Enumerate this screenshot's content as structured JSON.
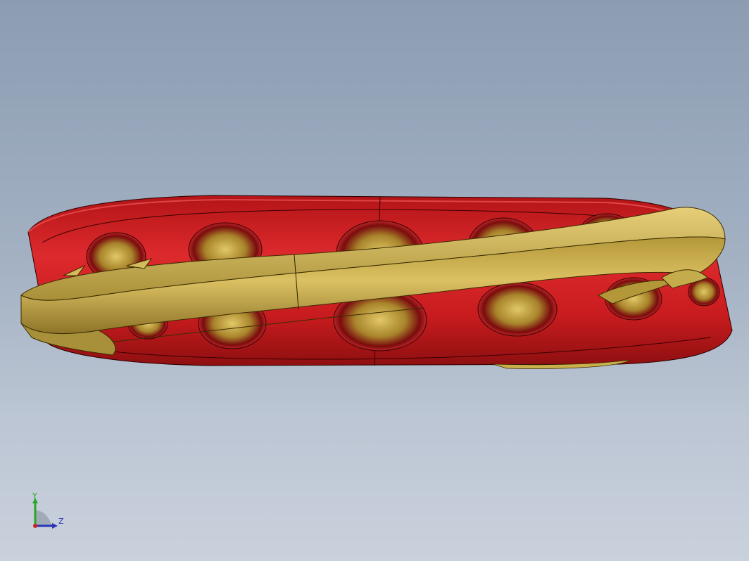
{
  "viewport": {
    "background_top": "#8c9db2",
    "background_bottom": "#c9d1dc"
  },
  "model": {
    "outer_ring_color": "#d5262a",
    "outer_ring_shadow": "#8e0f10",
    "cage_color": "#c9b04e",
    "cage_shadow": "#7a6523"
  },
  "triad": {
    "y_label": "Y",
    "z_label": "Z",
    "y_color": "#2aa52a",
    "z_color": "#2a36b8",
    "origin_color": "#d42020",
    "plane_color": "#9aa4b0"
  }
}
